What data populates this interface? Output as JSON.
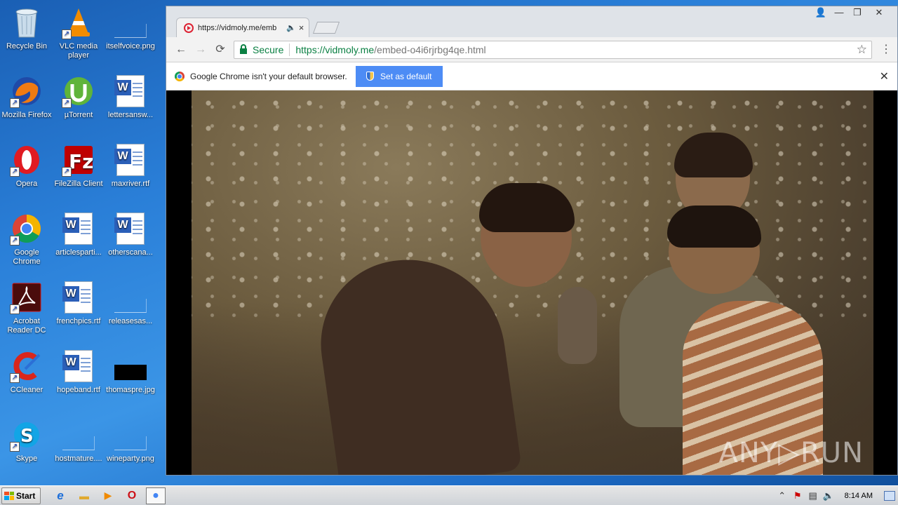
{
  "desktop": {
    "icons": [
      {
        "label": "Recycle Bin",
        "icon": "recycle-bin-icon"
      },
      {
        "label": "VLC media player",
        "icon": "vlc-icon"
      },
      {
        "label": "itselfvoice.png",
        "icon": "png-file-icon"
      },
      {
        "label": "Mozilla Firefox",
        "icon": "firefox-icon"
      },
      {
        "label": "µTorrent",
        "icon": "utorrent-icon"
      },
      {
        "label": "lettersansw...",
        "icon": "rtf-file-icon"
      },
      {
        "label": "Opera",
        "icon": "opera-icon"
      },
      {
        "label": "FileZilla Client",
        "icon": "filezilla-icon"
      },
      {
        "label": "maxriver.rtf",
        "icon": "rtf-file-icon"
      },
      {
        "label": "Google Chrome",
        "icon": "chrome-icon"
      },
      {
        "label": "articlesparti...",
        "icon": "rtf-file-icon"
      },
      {
        "label": "otherscana...",
        "icon": "rtf-file-icon"
      },
      {
        "label": "Acrobat Reader DC",
        "icon": "acrobat-icon"
      },
      {
        "label": "frenchpics.rtf",
        "icon": "rtf-file-icon"
      },
      {
        "label": "releasesas...",
        "icon": "file-icon"
      },
      {
        "label": "CCleaner",
        "icon": "ccleaner-icon"
      },
      {
        "label": "hopeband.rtf",
        "icon": "rtf-file-icon"
      },
      {
        "label": "thomaspre.jpg",
        "icon": "jpg-file-icon"
      },
      {
        "label": "Skype",
        "icon": "skype-icon"
      },
      {
        "label": "hostmature....",
        "icon": "file-icon"
      },
      {
        "label": "wineparty.png",
        "icon": "png-file-icon"
      }
    ]
  },
  "browser": {
    "tab_title": "https://vidmoly.me/emb",
    "tab_close": "×",
    "window_controls": {
      "user": "👤",
      "minimize": "—",
      "restore": "❐",
      "close": "✕"
    },
    "nav": {
      "back": "←",
      "forward": "→",
      "reload": "⟳",
      "menu": "⋮"
    },
    "omnibox": {
      "secure_label": "Secure",
      "url_scheme_host": "https://vidmoly.me",
      "url_path": "/embed-o4i6rjrbg4qe.html",
      "bookmark": "☆"
    },
    "infobar": {
      "message": "Google Chrome isn't your default browser.",
      "button_label": "Set as default",
      "close": "✕"
    },
    "video": {
      "watermark": "ANY▷RUN"
    }
  },
  "taskbar": {
    "start_label": "Start",
    "apps": [
      {
        "name": "internet-explorer",
        "glyph": "e",
        "color": "#1e6fd9"
      },
      {
        "name": "explorer",
        "glyph": "▬",
        "color": "#e0a930"
      },
      {
        "name": "media-player",
        "glyph": "▶",
        "color": "#f08a00"
      },
      {
        "name": "opera",
        "glyph": "O",
        "color": "#cc0f16"
      },
      {
        "name": "chrome",
        "glyph": "●",
        "color": "#4285f4"
      }
    ],
    "tray": {
      "chevron": "⌃",
      "clock": "8:14 AM"
    }
  },
  "colors": {
    "secure_green": "#0b8043",
    "infobar_button": "#4d8cf5"
  }
}
